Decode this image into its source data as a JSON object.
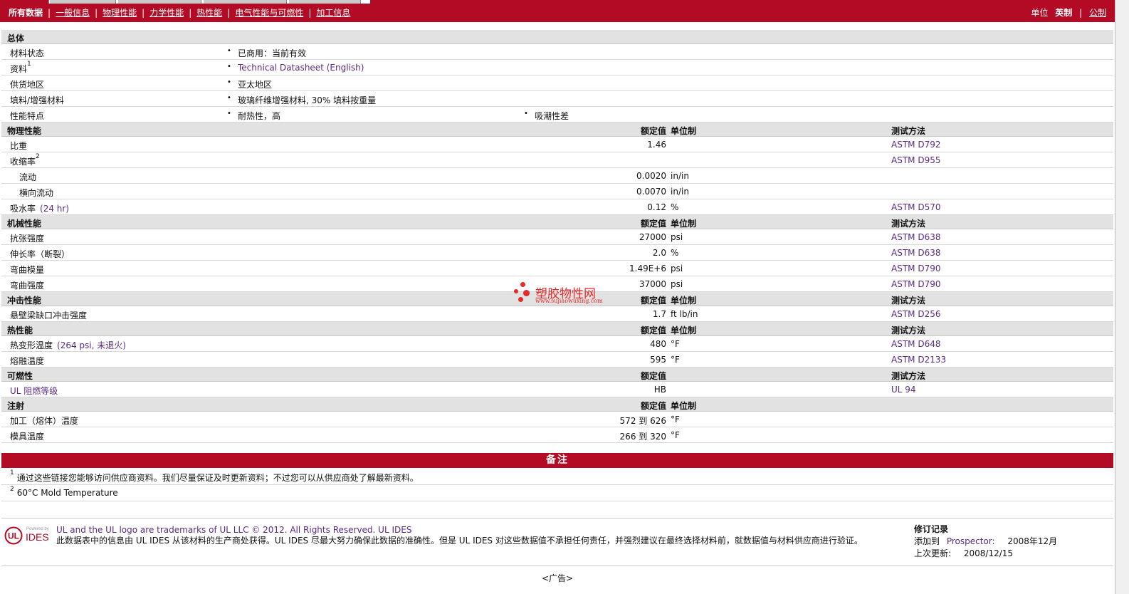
{
  "nav": {
    "items": [
      "所有数据",
      "一般信息",
      "物理性能",
      "力学性能",
      "热性能",
      "电气性能与可燃性",
      "加工信息"
    ],
    "units_label": "单位",
    "unit_options": [
      "英制",
      "公制"
    ]
  },
  "general": {
    "title": "总体",
    "rows": [
      {
        "label": "材料状态",
        "sup": "",
        "values": [
          "已商用：当前有效"
        ]
      },
      {
        "label": "资料",
        "sup": "1",
        "values": [
          "Technical Datasheet (English)"
        ]
      },
      {
        "label": "供货地区",
        "sup": "",
        "values": [
          "亚太地区"
        ]
      },
      {
        "label": "填料/增强材料",
        "sup": "",
        "values": [
          "玻璃纤维增强材料, 30% 填料按重量"
        ]
      },
      {
        "label": "性能特点",
        "sup": "",
        "values": [
          "耐热性，高",
          "吸潮性差"
        ]
      }
    ]
  },
  "headers": {
    "nominal": "额定值",
    "unit": "单位制",
    "method": "测试方法"
  },
  "sections": [
    {
      "title": "物理性能",
      "has_unit": true,
      "has_method": true,
      "rows": [
        {
          "label": "比重",
          "cond": "",
          "sup": "",
          "indent": false,
          "value": "1.46",
          "unit": "",
          "method": "ASTM D792"
        },
        {
          "label": "收缩率",
          "cond": "",
          "sup": "2",
          "indent": false,
          "value": "",
          "unit": "",
          "method": "ASTM D955"
        },
        {
          "label": "流动",
          "cond": "",
          "sup": "",
          "indent": true,
          "value": "0.0020",
          "unit": "in/in",
          "method": ""
        },
        {
          "label": "横向流动",
          "cond": "",
          "sup": "",
          "indent": true,
          "value": "0.0070",
          "unit": "in/in",
          "method": ""
        },
        {
          "label": "吸水率",
          "cond": "(24 hr)",
          "sup": "",
          "indent": false,
          "value": "0.12",
          "unit": "%",
          "method": "ASTM D570"
        }
      ]
    },
    {
      "title": "机械性能",
      "has_unit": true,
      "has_method": true,
      "rows": [
        {
          "label": "抗张强度",
          "cond": "",
          "sup": "",
          "indent": false,
          "value": "27000",
          "unit": "psi",
          "method": "ASTM D638"
        },
        {
          "label": "伸长率（断裂）",
          "cond": "",
          "sup": "",
          "indent": false,
          "value": "2.0",
          "unit": "%",
          "method": "ASTM D638"
        },
        {
          "label": "弯曲模量",
          "cond": "",
          "sup": "",
          "indent": false,
          "value": "1.49E+6",
          "unit": "psi",
          "method": "ASTM D790"
        },
        {
          "label": "弯曲强度",
          "cond": "",
          "sup": "",
          "indent": false,
          "value": "37000",
          "unit": "psi",
          "method": "ASTM D790"
        }
      ]
    },
    {
      "title": "冲击性能",
      "has_unit": true,
      "has_method": true,
      "rows": [
        {
          "label": "悬壁梁缺口冲击强度",
          "cond": "",
          "sup": "",
          "indent": false,
          "value": "1.7",
          "unit": "ft lb/in",
          "method": "ASTM D256"
        }
      ]
    },
    {
      "title": "热性能",
      "has_unit": true,
      "has_method": true,
      "rows": [
        {
          "label": "热变形温度",
          "cond": "(264 psi, 未退火)",
          "sup": "",
          "indent": false,
          "value": "480",
          "unit": "°F",
          "method": "ASTM D648"
        },
        {
          "label": "熔融温度",
          "cond": "",
          "sup": "",
          "indent": false,
          "value": "595",
          "unit": "°F",
          "method": "ASTM D2133"
        }
      ]
    },
    {
      "title": "可燃性",
      "has_unit": false,
      "has_method": true,
      "rows": [
        {
          "label": "UL 阻燃等级",
          "cond": "",
          "sup": "",
          "indent": false,
          "value": "HB",
          "unit": "",
          "method": "UL 94"
        }
      ]
    },
    {
      "title": "注射",
      "has_unit": true,
      "has_method": false,
      "rows": [
        {
          "label": "加工（熔体）温度",
          "cond": "",
          "sup": "",
          "indent": false,
          "value": "572 到  626",
          "unit": "°F",
          "method": ""
        },
        {
          "label": "模具温度",
          "cond": "",
          "sup": "",
          "indent": false,
          "value": "266 到  320",
          "unit": "°F",
          "method": ""
        }
      ]
    }
  ],
  "notes": {
    "title": "备注",
    "items": [
      {
        "num": "1",
        "text": "通过这些链接您能够访问供应商资料。我们尽量保证及时更新资料；不过您可以从供应商处了解最新资料。"
      },
      {
        "num": "2",
        "text": "60°C Mold Temperature"
      }
    ]
  },
  "footer": {
    "logo_small": "Powered by",
    "logo_ul": "UL",
    "logo_ides": "IDES",
    "trademark": "UL and the UL logo are trademarks of UL LLC © 2012. All Rights Reserved. UL IDES",
    "disclaimer": "此数据表中的信息由  UL IDES 从该材料的生产商处获得。UL IDES 尽最大努力确保此数据的准确性。但是  UL IDES 对这些数据值不承担任何责任，并强烈建议在最终选择材料前，就数据值与材料供应商进行验证。",
    "rev_title": "修订记录",
    "added_label": "添加到",
    "added_link": "Prospector:",
    "added_date": "2008年12月",
    "updated_label": "上次更新:",
    "updated_date": "2008/12/15"
  },
  "ad": "<广告>",
  "watermark": {
    "text": "塑胶物性网",
    "url": "www.sujiaowuxing.com"
  }
}
